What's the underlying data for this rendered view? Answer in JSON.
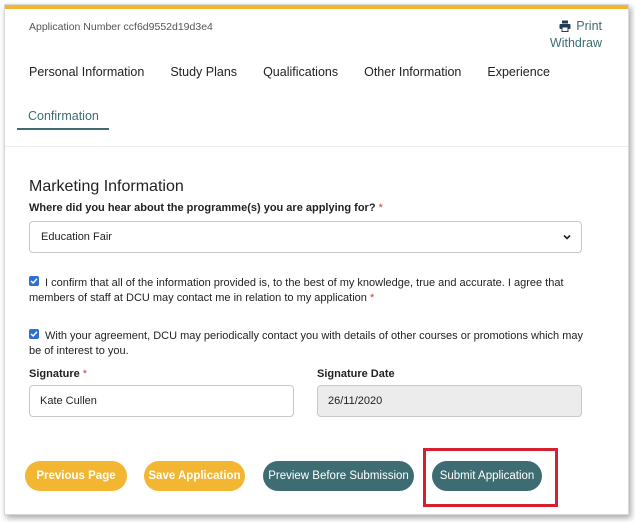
{
  "header": {
    "application_number": "Application Number ccf6d9552d19d3e4",
    "print_label": "Print",
    "withdraw_label": "Withdraw"
  },
  "tabs": [
    {
      "label": "Personal Information"
    },
    {
      "label": "Study Plans"
    },
    {
      "label": "Qualifications"
    },
    {
      "label": "Other Information"
    },
    {
      "label": "Experience"
    },
    {
      "label": "Confirmation"
    }
  ],
  "marketing": {
    "title": "Marketing Information",
    "question": "Where did you hear about the programme(s) you are applying for?",
    "required_mark": "*",
    "selected_value": "Education Fair"
  },
  "confirmations": [
    {
      "text": "I confirm that all of the information provided is, to the best of my knowledge, true and accurate. I agree that members of staff at DCU may contact me in relation to my application",
      "required_mark": "*",
      "checked": true
    },
    {
      "text": "With your agreement, DCU may periodically contact you with details of other courses or promotions which may be of interest to you.",
      "checked": true
    }
  ],
  "signature": {
    "label": "Signature",
    "required_mark": "*",
    "value": "Kate Cullen"
  },
  "signature_date": {
    "label": "Signature Date",
    "value": "26/11/2020"
  },
  "actions": {
    "previous_label": "Previous Page",
    "save_label": "Save Application",
    "preview_label": "Preview Before Submission",
    "submit_label": "Submit Application"
  },
  "colors": {
    "accent_yellow": "#f2b632",
    "accent_teal": "#3d6d73",
    "required_red": "#d23b3b",
    "highlight_red": "#d6202f"
  }
}
